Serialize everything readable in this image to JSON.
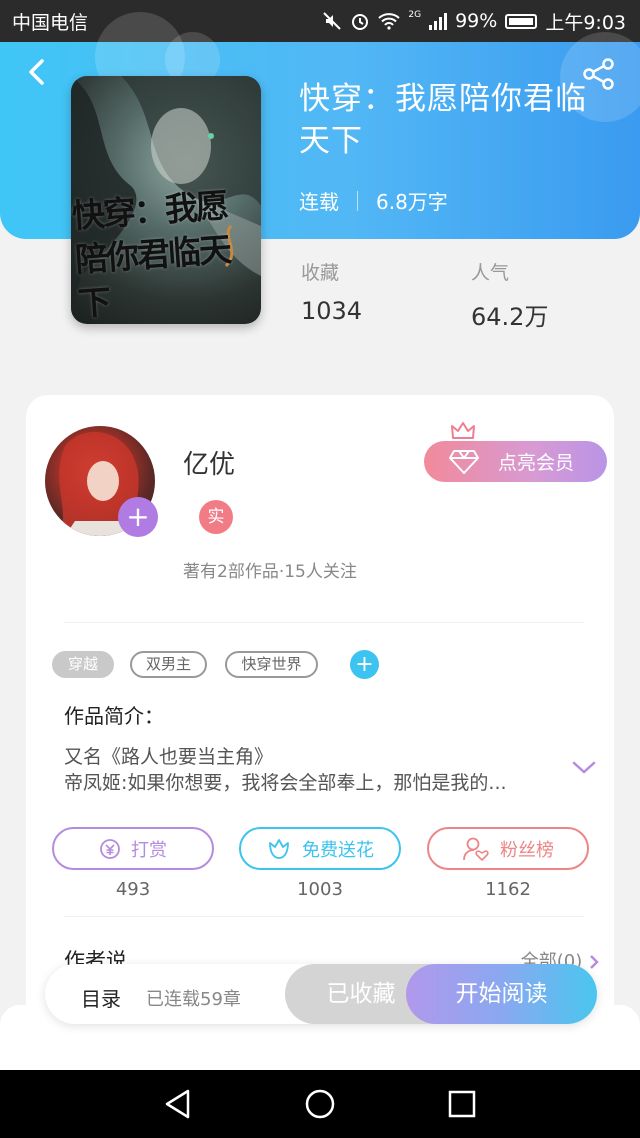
{
  "status_bar": {
    "carrier": "中国电信",
    "network": "2G",
    "battery": "99%",
    "time": "上午9:03"
  },
  "book": {
    "title": "快穿：我愿陪你君临天下",
    "cover_text": "快穿：我愿陪你君临天下",
    "status": "连载",
    "word_count": "6.8万字",
    "favorites_label": "收藏",
    "favorites_value": "1034",
    "popularity_label": "人气",
    "popularity_value": "64.2万"
  },
  "author": {
    "name": "亿优",
    "badge": "实",
    "stats": "著有2部作品·15人关注",
    "vip_button": "点亮会员"
  },
  "tags": [
    "穿越",
    "双男主",
    "快穿世界"
  ],
  "intro": {
    "heading": "作品简介：",
    "line1": "又名《路人也要当主角》",
    "line2": "帝凤姬:如果你想要，我将会全部奉上，那怕是我的..."
  },
  "actions": [
    {
      "label": "打赏",
      "count": "493"
    },
    {
      "label": "免费送花",
      "count": "1003"
    },
    {
      "label": "粉丝榜",
      "count": "1162"
    }
  ],
  "author_says": {
    "title": "作者说",
    "all": "全部(0)"
  },
  "bottom_bar": {
    "toc": "目录",
    "chapters": "已连载59章",
    "collected": "已收藏",
    "read": "开始阅读"
  },
  "colors": {
    "header_blue": "#3fc6f6",
    "reward_purple": "#b58be0",
    "flower_cyan": "#3cc3ef",
    "fans_red": "#ec8686"
  }
}
